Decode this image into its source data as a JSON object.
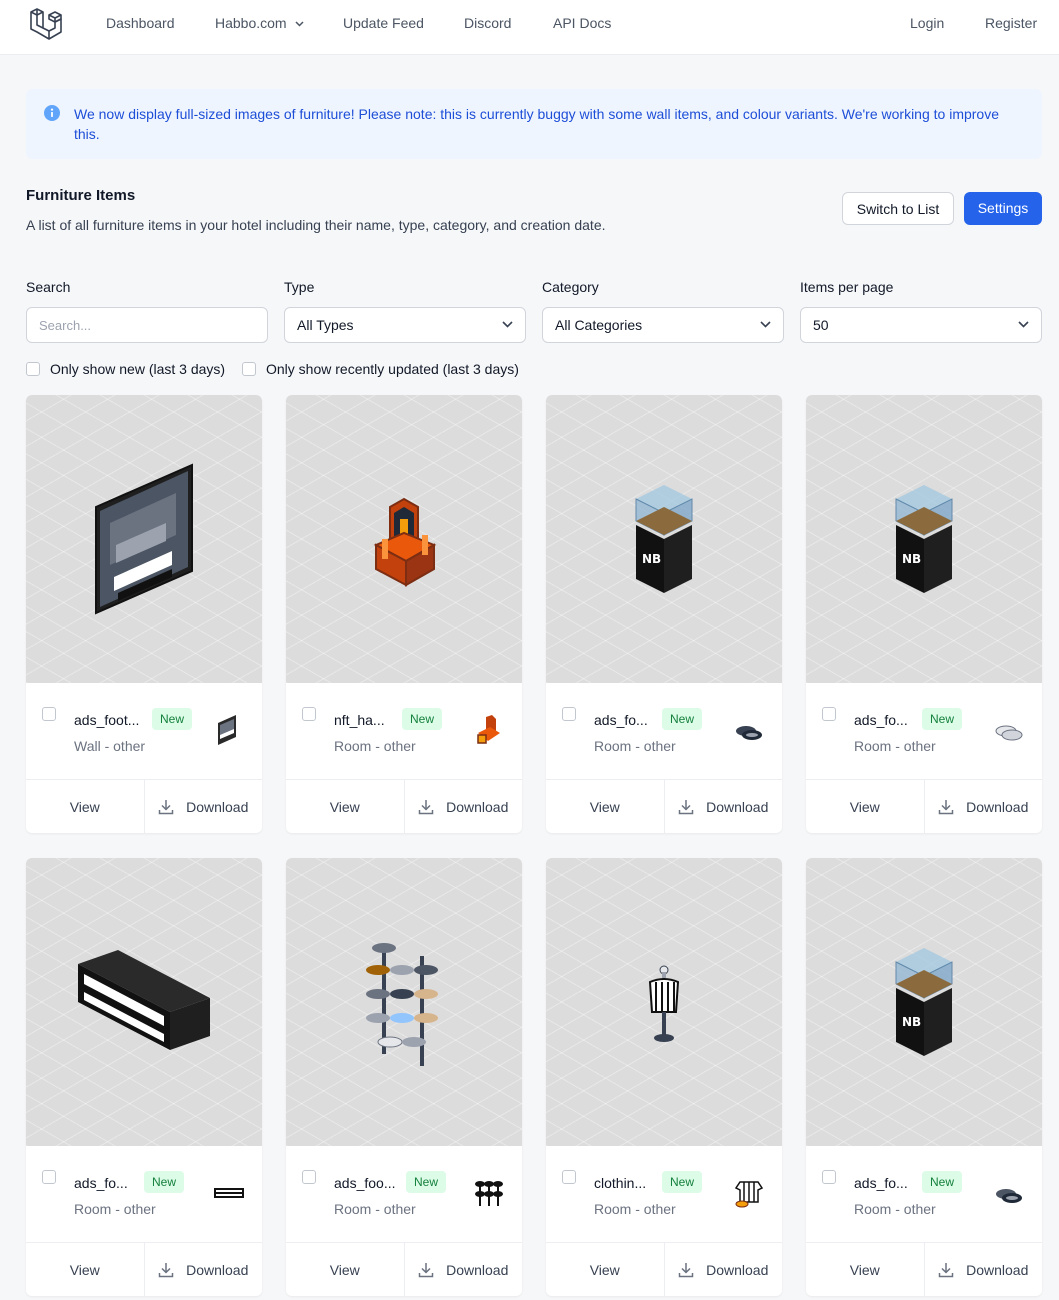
{
  "nav": {
    "links": [
      {
        "label": "Dashboard"
      },
      {
        "label": "Habbo.com"
      },
      {
        "label": "Update Feed"
      },
      {
        "label": "Discord"
      },
      {
        "label": "API Docs"
      }
    ],
    "login": "Login",
    "register": "Register"
  },
  "alert": {
    "message": "We now display full-sized images of furniture! Please note: this is currently buggy with some wall items, and colour variants. We're working to improve this."
  },
  "section": {
    "title": "Furniture Items",
    "description": "A list of all furniture items in your hotel including their name, type, category, and creation date.",
    "switch_label": "Switch to List",
    "settings_label": "Settings"
  },
  "filters": {
    "search_label": "Search",
    "search_placeholder": "Search...",
    "type_label": "Type",
    "type_value": "All Types",
    "category_label": "Category",
    "category_value": "All Categories",
    "per_page_label": "Items per page",
    "per_page_value": "50",
    "only_new": "Only show new (last 3 days)",
    "only_updated": "Only show recently updated (last 3 days)"
  },
  "cards": [
    {
      "name": "ads_foot...",
      "badge": "New",
      "type": "Wall - other",
      "view": "View",
      "download": "Download",
      "art": "poster"
    },
    {
      "name": "nft_ha...",
      "badge": "New",
      "type": "Room - other",
      "view": "View",
      "download": "Download",
      "art": "throne"
    },
    {
      "name": "ads_fo...",
      "badge": "New",
      "type": "Room - other",
      "view": "View",
      "download": "Download",
      "art": "case-dark"
    },
    {
      "name": "ads_fo...",
      "badge": "New",
      "type": "Room - other",
      "view": "View",
      "download": "Download",
      "art": "case-white"
    },
    {
      "name": "ads_fo...",
      "badge": "New",
      "type": "Room - other",
      "view": "View",
      "download": "Download",
      "art": "box"
    },
    {
      "name": "ads_foo...",
      "badge": "New",
      "type": "Room - other",
      "view": "View",
      "download": "Download",
      "art": "rack"
    },
    {
      "name": "clothin...",
      "badge": "New",
      "type": "Room - other",
      "view": "View",
      "download": "Download",
      "art": "mannequin"
    },
    {
      "name": "ads_fo...",
      "badge": "New",
      "type": "Room - other",
      "view": "View",
      "download": "Download",
      "art": "case-dark"
    }
  ],
  "colors": {
    "accent": "#2563eb",
    "badge_bg": "#dcfce7",
    "badge_text": "#15803d",
    "alert_bg": "#eff5fe",
    "alert_text": "#1d4ed8"
  }
}
